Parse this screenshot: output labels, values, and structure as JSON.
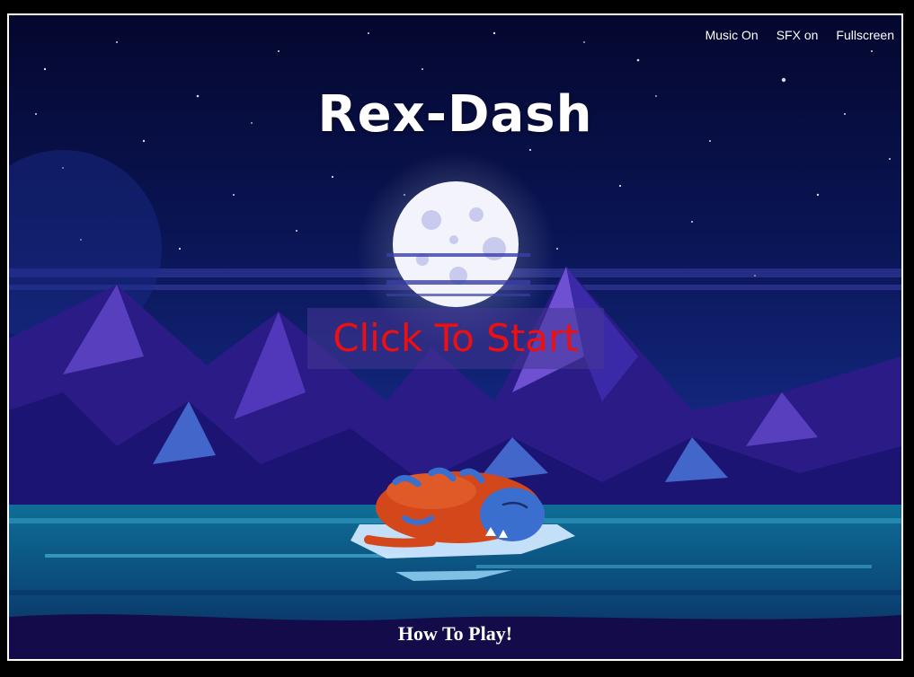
{
  "menu": {
    "music": "Music On",
    "sfx": "SFX on",
    "fullscreen": "Fullscreen"
  },
  "title": "Rex-Dash",
  "start_button": "Click To Start",
  "how_to_play": "How To Play!",
  "colors": {
    "sky_top": "#04072e",
    "sky_mid": "#12257a",
    "moon": "#f2f3fb",
    "mountain_dark": "#2a1b86",
    "mountain_light": "#6b4fd4",
    "water": "#0e5a8a",
    "start_text": "#ee1010",
    "dino_body": "#d4471b",
    "dino_stripe": "#3b6fcf"
  },
  "icons": {
    "moon": "moon-icon",
    "mascot": "sleeping-dino-mascot"
  }
}
